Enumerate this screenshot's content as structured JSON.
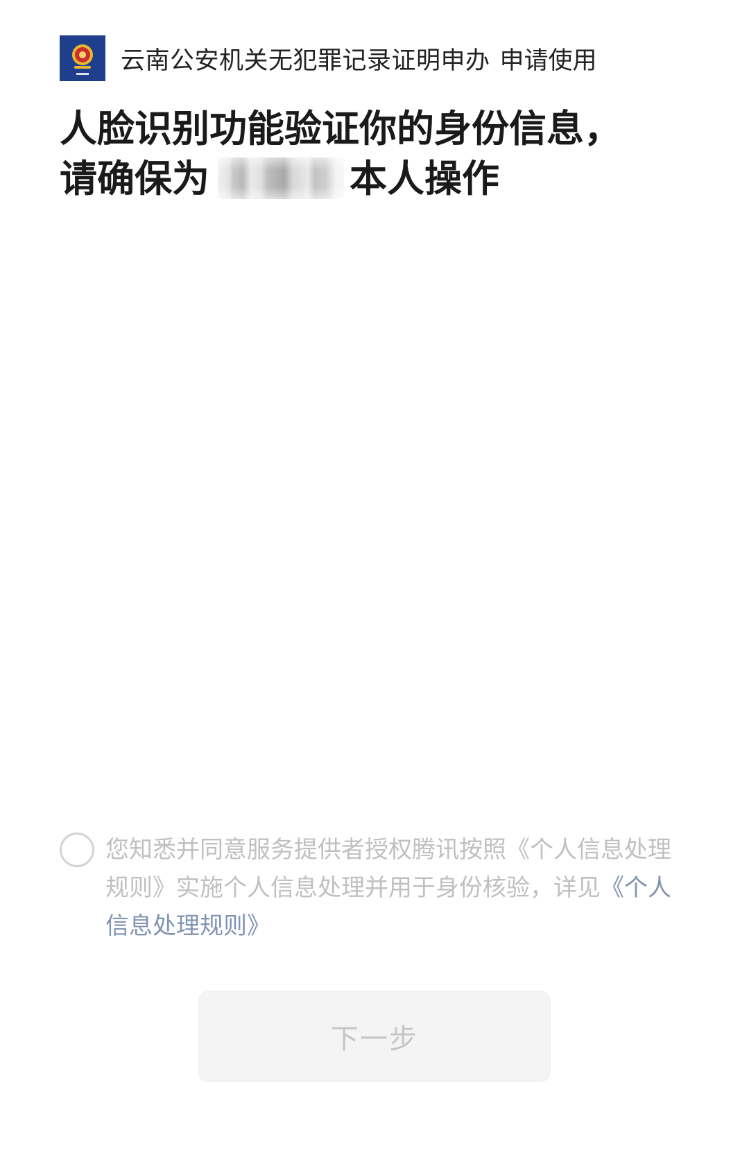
{
  "header": {
    "app_name": "云南公安机关无犯罪记录证明申办",
    "action_label": "申请使用"
  },
  "headline": {
    "line1": "人脸识别功能验证你的身份信息，",
    "line2_prefix": "请确保为",
    "line2_suffix": "本人操作"
  },
  "consent": {
    "text_before": "您知悉并同意服务提供者授权腾讯按照《个人信息处理规则》实施个人信息处理并用于身份核验，详见",
    "link_label": "《个人信息处理规则》",
    "checked": false
  },
  "buttons": {
    "next_label": "下一步"
  },
  "colors": {
    "logo_background": "#1f3f8d",
    "link": "#8193b2",
    "disabled_button_bg": "#f4f4f4"
  },
  "icons": {
    "logo": "police-emblem-icon",
    "consent_checkbox": "radio-circle-icon"
  }
}
